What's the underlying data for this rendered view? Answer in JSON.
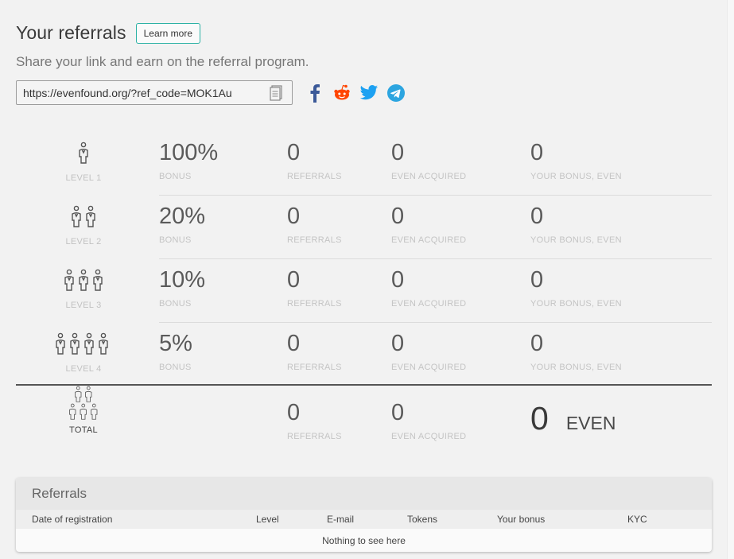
{
  "header": {
    "title": "Your referrals",
    "learn_more": "Learn more"
  },
  "subtitle": "Share your link and earn on the referral program.",
  "ref_link": {
    "value": "https://evenfound.org/?ref_code=MOK1Au",
    "copy_icon": "copy-icon"
  },
  "socials": [
    {
      "name": "facebook-icon",
      "color": "#3b5998"
    },
    {
      "name": "reddit-icon",
      "color": "#ff4500"
    },
    {
      "name": "twitter-icon",
      "color": "#1da1f2"
    },
    {
      "name": "telegram-icon",
      "color": "#2ca5e0"
    }
  ],
  "levels": [
    {
      "label": "LEVEL 1",
      "bonus": "100%",
      "bonus_label": "BONUS",
      "referrals": "0",
      "referrals_label": "REFERRALS",
      "acquired": "0",
      "acquired_label": "EVEN ACQUIRED",
      "your_bonus": "0",
      "your_bonus_label": "YOUR BONUS, EVEN"
    },
    {
      "label": "LEVEL 2",
      "bonus": "20%",
      "bonus_label": "BONUS",
      "referrals": "0",
      "referrals_label": "REFERRALS",
      "acquired": "0",
      "acquired_label": "EVEN ACQUIRED",
      "your_bonus": "0",
      "your_bonus_label": "YOUR BONUS, EVEN"
    },
    {
      "label": "LEVEL 3",
      "bonus": "10%",
      "bonus_label": "BONUS",
      "referrals": "0",
      "referrals_label": "REFERRALS",
      "acquired": "0",
      "acquired_label": "EVEN ACQUIRED",
      "your_bonus": "0",
      "your_bonus_label": "YOUR BONUS, EVEN"
    },
    {
      "label": "LEVEL 4",
      "bonus": "5%",
      "bonus_label": "BONUS",
      "referrals": "0",
      "referrals_label": "REFERRALS",
      "acquired": "0",
      "acquired_label": "EVEN ACQUIRED",
      "your_bonus": "0",
      "your_bonus_label": "YOUR BONUS, EVEN"
    }
  ],
  "total": {
    "label": "TOTAL",
    "referrals": "0",
    "referrals_label": "REFERRALS",
    "acquired": "0",
    "acquired_label": "EVEN ACQUIRED",
    "amount": "0",
    "unit": "EVEN"
  },
  "referrals_table": {
    "title": "Referrals",
    "columns": [
      "Date of registration",
      "Level",
      "E-mail",
      "Tokens",
      "Your bonus",
      "KYC"
    ],
    "empty": "Nothing to see here"
  },
  "colors": {
    "accent": "#2bb1a4",
    "background": "#f2f2f2"
  }
}
